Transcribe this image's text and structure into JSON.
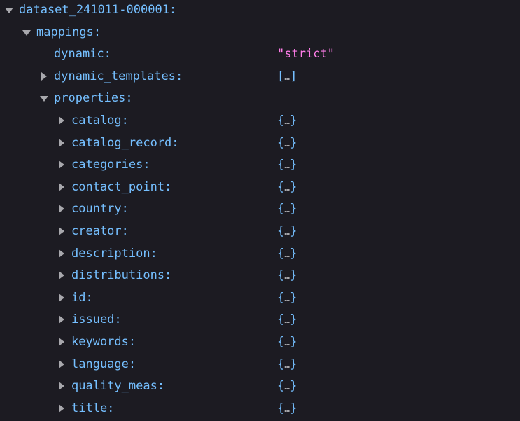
{
  "colors": {
    "background": "#1c1b22",
    "key": "#75bfff",
    "string": "#ff7de9",
    "twisty": "#a8a8ad"
  },
  "rows": [
    {
      "level": 0,
      "key": "dataset_241011-000001:",
      "twisty": "open",
      "value": null
    },
    {
      "level": 1,
      "key": "mappings:",
      "twisty": "open",
      "value": null
    },
    {
      "level": 2,
      "key": "dynamic:",
      "twisty": "none",
      "value": "\"strict\"",
      "type": "string"
    },
    {
      "level": 2,
      "key": "dynamic_templates:",
      "twisty": "closed",
      "value": "[…]",
      "type": "array"
    },
    {
      "level": 2,
      "key": "properties:",
      "twisty": "open",
      "value": null
    },
    {
      "level": 3,
      "key": "catalog:",
      "twisty": "closed",
      "value": "{…}",
      "type": "object"
    },
    {
      "level": 3,
      "key": "catalog_record:",
      "twisty": "closed",
      "value": "{…}",
      "type": "object"
    },
    {
      "level": 3,
      "key": "categories:",
      "twisty": "closed",
      "value": "{…}",
      "type": "object"
    },
    {
      "level": 3,
      "key": "contact_point:",
      "twisty": "closed",
      "value": "{…}",
      "type": "object"
    },
    {
      "level": 3,
      "key": "country:",
      "twisty": "closed",
      "value": "{…}",
      "type": "object"
    },
    {
      "level": 3,
      "key": "creator:",
      "twisty": "closed",
      "value": "{…}",
      "type": "object"
    },
    {
      "level": 3,
      "key": "description:",
      "twisty": "closed",
      "value": "{…}",
      "type": "object"
    },
    {
      "level": 3,
      "key": "distributions:",
      "twisty": "closed",
      "value": "{…}",
      "type": "object"
    },
    {
      "level": 3,
      "key": "id:",
      "twisty": "closed",
      "value": "{…}",
      "type": "object"
    },
    {
      "level": 3,
      "key": "issued:",
      "twisty": "closed",
      "value": "{…}",
      "type": "object"
    },
    {
      "level": 3,
      "key": "keywords:",
      "twisty": "closed",
      "value": "{…}",
      "type": "object"
    },
    {
      "level": 3,
      "key": "language:",
      "twisty": "closed",
      "value": "{…}",
      "type": "object"
    },
    {
      "level": 3,
      "key": "quality_meas:",
      "twisty": "closed",
      "value": "{…}",
      "type": "object"
    },
    {
      "level": 3,
      "key": "title:",
      "twisty": "closed",
      "value": "{…}",
      "type": "object"
    }
  ]
}
